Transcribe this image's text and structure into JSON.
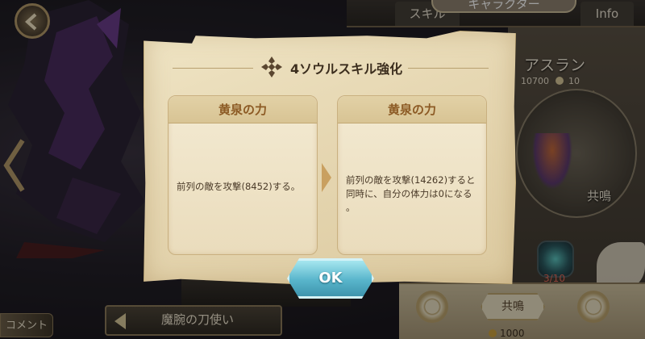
{
  "top_tabs": {
    "skill": "スキル",
    "character": "キャラクター",
    "info": "Info"
  },
  "hero": {
    "name": "アスラン",
    "stat_a": "10700",
    "stat_b": "10",
    "resonance_label": "共鳴",
    "gem_count": "3/10",
    "selector_name": "魔腕の刀使い"
  },
  "bottom": {
    "resonance_button": "共鳴",
    "gold": "1000"
  },
  "comment_label": "コメント",
  "dialog": {
    "title": "4ソウルスキル強化",
    "before": {
      "skill_name": "黄泉の力",
      "description": "前列の敵を攻撃(8452)する。"
    },
    "after": {
      "skill_name": "黄泉の力",
      "description": "前列の敵を攻撃(14262)すると同時に、自分の体力は0になる 。"
    },
    "ok_label": "OK"
  },
  "icons": {
    "back": "back-arrow-icon",
    "title": "soul-emblem-icon",
    "arrow": "right-arrow-icon"
  }
}
